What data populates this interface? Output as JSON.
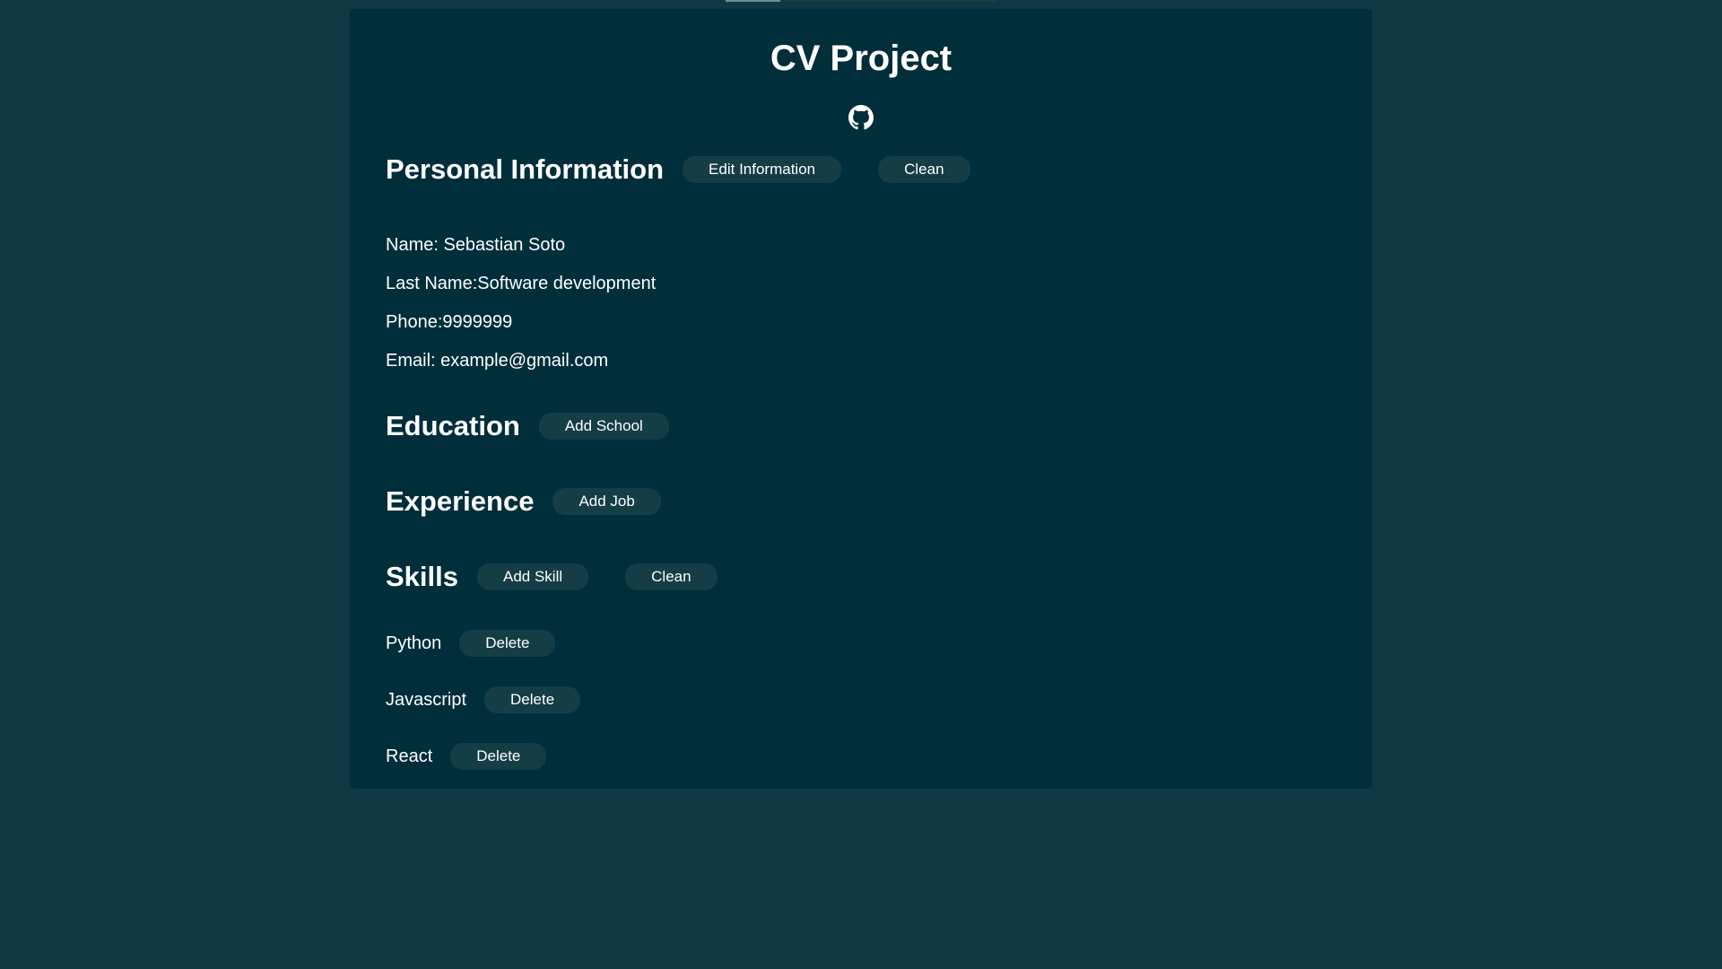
{
  "app": {
    "title": "CV Project",
    "github_icon": "github-icon"
  },
  "personal": {
    "heading": "Personal Information",
    "edit_label": "Edit Information",
    "clean_label": "Clean",
    "name_line": "Name: Sebastian Soto",
    "lastname_line": "Last Name:Software development",
    "phone_line": "Phone:9999999",
    "email_line": "Email: example@gmail.com"
  },
  "education": {
    "heading": "Education",
    "add_label": "Add School"
  },
  "experience": {
    "heading": "Experience",
    "add_label": "Add Job"
  },
  "skills": {
    "heading": "Skills",
    "add_label": "Add Skill",
    "clean_label": "Clean",
    "items": [
      {
        "name": "Python",
        "delete_label": "Delete"
      },
      {
        "name": "Javascript",
        "delete_label": "Delete"
      },
      {
        "name": "React",
        "delete_label": "Delete"
      }
    ]
  },
  "colors": {
    "page_background": "#103842",
    "card_background": "#002e3b",
    "button_background": "#143d46",
    "text": "#ffffff"
  }
}
